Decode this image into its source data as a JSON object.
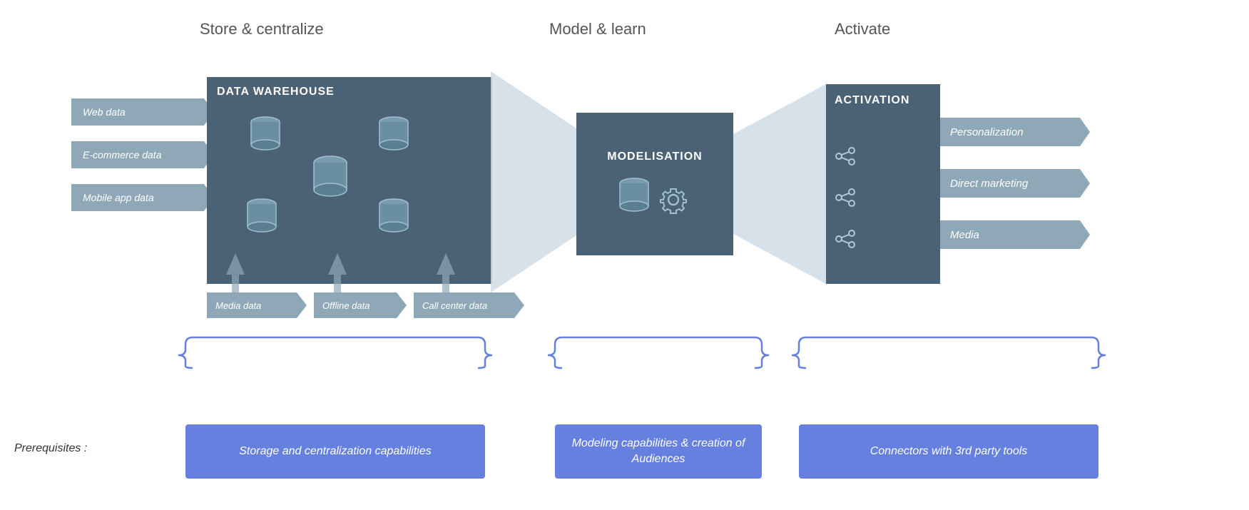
{
  "columns": {
    "store": "Store & centralize",
    "model": "Model & learn",
    "activate": "Activate"
  },
  "warehouse": {
    "title": "DATA WAREHOUSE",
    "left_sources": [
      {
        "label": "Web data"
      },
      {
        "label": "E-commerce data"
      },
      {
        "label": "Mobile app data"
      }
    ],
    "bottom_sources": [
      {
        "label": "Media data"
      },
      {
        "label": "Offline data"
      },
      {
        "label": "Call center data"
      }
    ]
  },
  "modelisation": {
    "title": "MODELISATION"
  },
  "activation": {
    "title": "ACTIVATION",
    "outputs": [
      {
        "label": "Personalization"
      },
      {
        "label": "Direct marketing"
      },
      {
        "label": "Media"
      }
    ]
  },
  "prerequisites": {
    "label": "Prerequisites :",
    "capabilities": [
      {
        "text": "Storage and centralization capabilities"
      },
      {
        "text": "Modeling capabilities & creation of Audiences"
      },
      {
        "text": "Connectors with 3rd party tools"
      }
    ]
  }
}
